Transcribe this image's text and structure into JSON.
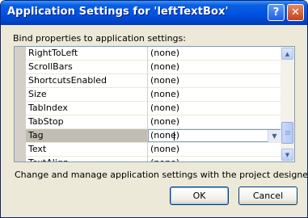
{
  "dialog": {
    "title": "Application Settings for 'leftTextBox'",
    "help_label": "?",
    "close_label": "✕",
    "prompt": "Bind properties to application settings:",
    "hint": "Change and manage application settings with the project designer.",
    "ok_label": "OK",
    "cancel_label": "Cancel"
  },
  "grid": {
    "rows": [
      {
        "name": "RightToLeft",
        "value": "(none)"
      },
      {
        "name": "ScrollBars",
        "value": "(none)"
      },
      {
        "name": "ShortcutsEnabled",
        "value": "(none)"
      },
      {
        "name": "Size",
        "value": "(none)"
      },
      {
        "name": "TabIndex",
        "value": "(none)"
      },
      {
        "name": "TabStop",
        "value": "(none)"
      },
      {
        "name": "Tag",
        "value": "(none)"
      },
      {
        "name": "Text",
        "value": "(none)"
      },
      {
        "name": "TextAlign",
        "value": "(none)"
      }
    ],
    "selected_index": 6
  },
  "colors": {
    "titlebar": "#0055e5",
    "selected_row": "#c0bdb4",
    "dialog_face": "#ece9d8"
  }
}
